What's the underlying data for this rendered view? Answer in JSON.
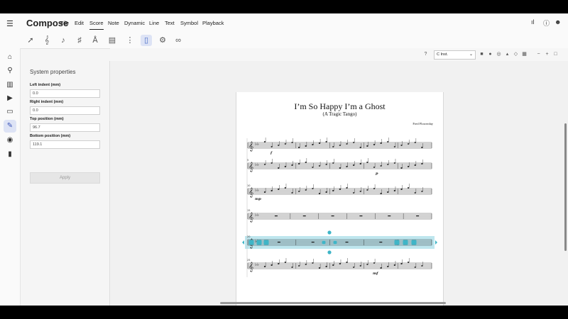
{
  "app": {
    "name": "Compose"
  },
  "menu": [
    "File",
    "Edit",
    "Score",
    "Note",
    "Dynamic",
    "Line",
    "Text",
    "Symbol",
    "Playback"
  ],
  "menu_active": "Score",
  "topright_icons": [
    "instrument-icon",
    "help-icon",
    "account-icon"
  ],
  "toolbar_icons": [
    "arrow-select-icon",
    "treble-clef-icon",
    "time-signature-icon",
    "key-signature-icon",
    "instrument-name-icon",
    "measure-icon",
    "clef-change-icon",
    "page-layout-icon",
    "settings-icon",
    "link-icon"
  ],
  "nav_icons": [
    "home-icon",
    "search-icon",
    "library-icon",
    "video-icon",
    "folder-icon",
    "score-edit-icon",
    "eye-icon",
    "exit-icon"
  ],
  "props": {
    "title": "System properties",
    "fields": [
      {
        "label": "Left indent (mm)",
        "value": "0.0"
      },
      {
        "label": "Right indent (mm)",
        "value": "0.0"
      },
      {
        "label": "Top position (mm)",
        "value": "96.7"
      },
      {
        "label": "Bottom position (mm)",
        "value": "119.1"
      }
    ],
    "apply": "Apply"
  },
  "viewbar": {
    "instrument": "C Inst."
  },
  "score": {
    "title": "I’m So Happy I’m a Ghost",
    "subtitle": "(A Tragic Tango)",
    "composer": "Fred Flowerday",
    "measure_numbers": [
      "5",
      "10",
      "15",
      "20",
      "25"
    ],
    "dynamics": [
      "f",
      "p",
      "mp",
      "mf"
    ]
  },
  "colors": {
    "selection": "#a8dde8",
    "handle": "#3fb5c7",
    "nav_selected": "#dde3f5"
  }
}
